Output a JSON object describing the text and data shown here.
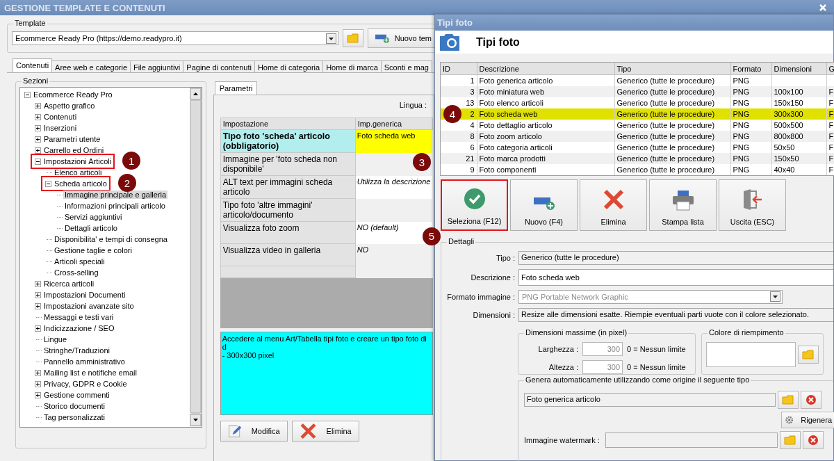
{
  "window": {
    "title": "GESTIONE TEMPLATE E CONTENUTI"
  },
  "template": {
    "label": "Template",
    "value": "Ecommerce Ready Pro (https://demo.readypro.it)",
    "new_button": "Nuovo tem"
  },
  "tabs": [
    {
      "label": "Contenuti",
      "selected": true
    },
    {
      "label": "Aree web e categorie",
      "selected": false
    },
    {
      "label": "File aggiuntivi",
      "selected": false
    },
    {
      "label": "Pagine di contenuti",
      "selected": false
    },
    {
      "label": "Home di categoria",
      "selected": false
    },
    {
      "label": "Home di marca",
      "selected": false
    },
    {
      "label": "Sconti e mag",
      "selected": false
    }
  ],
  "sections": {
    "label": "Sezioni",
    "tree": [
      {
        "label": "Ecommerce Ready Pro",
        "expanded": true,
        "selected": false,
        "children": [
          {
            "label": "Aspetto grafico",
            "expanded": false,
            "selected": false
          },
          {
            "label": "Contenuti",
            "expanded": false,
            "selected": false
          },
          {
            "label": "Inserzioni",
            "expanded": false,
            "selected": false
          },
          {
            "label": "Parametri utente",
            "expanded": false,
            "selected": false
          },
          {
            "label": "Carrello ed Ordini",
            "expanded": false,
            "selected": false
          },
          {
            "label": "Impostazioni Articoli",
            "expanded": true,
            "selected": false,
            "callout": "1",
            "children": [
              {
                "label": "Elenco articoli",
                "selected": false
              },
              {
                "label": "Scheda articolo",
                "expanded": true,
                "selected": false,
                "callout": "2",
                "children": [
                  {
                    "label": "Immagine principale e galleria",
                    "selected": true
                  },
                  {
                    "label": "Informazioni principali articolo",
                    "selected": false
                  },
                  {
                    "label": "Servizi aggiuntivi",
                    "selected": false
                  },
                  {
                    "label": "Dettagli articolo",
                    "selected": false
                  }
                ]
              },
              {
                "label": "Disponibilita' e tempi di consegna",
                "selected": false
              },
              {
                "label": "Gestione taglie e colori",
                "selected": false
              },
              {
                "label": "Articoli speciali",
                "selected": false
              },
              {
                "label": "Cross-selling",
                "selected": false
              }
            ]
          },
          {
            "label": "Ricerca articoli",
            "expanded": false,
            "selected": false
          },
          {
            "label": "Impostazioni Documenti",
            "expanded": false,
            "selected": false
          },
          {
            "label": "Impostazioni avanzate sito",
            "expanded": false,
            "selected": false
          },
          {
            "label": "Messaggi e testi vari",
            "selected": false
          },
          {
            "label": "Indicizzazione / SEO",
            "expanded": false,
            "selected": false
          },
          {
            "label": "Lingue",
            "selected": false
          },
          {
            "label": "Stringhe/Traduzioni",
            "selected": false
          },
          {
            "label": "Pannello amministrativo",
            "selected": false
          },
          {
            "label": "Mailing list e notifiche email",
            "expanded": false,
            "selected": false
          },
          {
            "label": "Privacy, GDPR e Cookie",
            "expanded": false,
            "selected": false
          },
          {
            "label": "Gestione commenti",
            "expanded": false,
            "selected": false
          },
          {
            "label": "Storico documenti",
            "selected": false
          },
          {
            "label": "Tag personalizzati",
            "selected": false
          }
        ]
      }
    ]
  },
  "params": {
    "tab": "Parametri",
    "language_label": "Lingua :",
    "columns": [
      "Impostazione",
      "Imp.generica"
    ],
    "rows": [
      {
        "setting": "Tipo foto 'scheda' articolo (obbligatorio)",
        "value": "Foto scheda web",
        "selected": true,
        "callout": "3"
      },
      {
        "setting": "Immagine per 'foto scheda non disponibile'",
        "selected": false
      },
      {
        "setting": "ALT text per immagini scheda articolo",
        "value": "Utilizza la descrizione",
        "selected": false
      },
      {
        "setting": "Tipo foto 'altre immagini' articolo/documento",
        "selected": false
      },
      {
        "setting": "Visualizza foto zoom",
        "value": "NO (default)",
        "selected": false
      },
      {
        "setting": "Visualizza video in galleria",
        "value": "NO",
        "selected": false
      }
    ],
    "description": "Accedere al menu Art/Tabella tipi foto e creare un tipo foto di d\n- 300x300 pixel",
    "buttons": [
      {
        "label": "Modifica",
        "kind": "edit"
      },
      {
        "label": "Elimina",
        "kind": "delete"
      }
    ]
  },
  "dialog": {
    "title": "Tipi foto",
    "heading": "Tipi foto",
    "columns": [
      "ID",
      "Descrizione",
      "Tipo",
      "Formato",
      "Dimensioni",
      "G"
    ],
    "rows": [
      {
        "id": "1",
        "description": "Foto generica articolo",
        "type": "Generico (tutte le procedure)",
        "format": "PNG",
        "selected": false
      },
      {
        "id": "3",
        "description": "Foto miniatura web",
        "type": "Generico (tutte le procedure)",
        "format": "PNG",
        "size": "100x100",
        "column_6": "F",
        "selected": false
      },
      {
        "id": "13",
        "description": "Foto elenco articoli",
        "type": "Generico (tutte le procedure)",
        "format": "PNG",
        "size": "150x150",
        "column_6": "F",
        "selected": false
      },
      {
        "id": "2",
        "description": "Foto scheda web",
        "type": "Generico (tutte le procedure)",
        "format": "PNG",
        "size": "300x300",
        "column_6": "F",
        "selected": true,
        "callout": "4"
      },
      {
        "id": "4",
        "description": "Foto dettaglio articolo",
        "type": "Generico (tutte le procedure)",
        "format": "PNG",
        "size": "500x500",
        "column_6": "F",
        "selected": false
      },
      {
        "id": "8",
        "description": "Foto zoom articolo",
        "type": "Generico (tutte le procedure)",
        "format": "PNG",
        "size": "800x800",
        "column_6": "F",
        "selected": false
      },
      {
        "id": "6",
        "description": "Foto categoria articoli",
        "type": "Generico (tutte le procedure)",
        "format": "PNG",
        "size": "50x50",
        "column_6": "F",
        "selected": false
      },
      {
        "id": "21",
        "description": "Foto marca prodotti",
        "type": "Generico (tutte le procedure)",
        "format": "PNG",
        "size": "150x50",
        "column_6": "F",
        "selected": false
      },
      {
        "id": "9",
        "description": "Foto componenti",
        "type": "Generico (tutte le procedure)",
        "format": "PNG",
        "size": "40x40",
        "column_6": "F",
        "selected": false
      }
    ],
    "toolbar": [
      {
        "label": "Seleziona (F12)",
        "kind": "select",
        "callout": "5"
      },
      {
        "label": "Nuovo (F4)",
        "kind": "new"
      },
      {
        "label": "Elimina",
        "kind": "delete"
      },
      {
        "label": "Stampa lista",
        "kind": "print"
      },
      {
        "label": "Uscita (ESC)",
        "kind": "exit"
      }
    ],
    "details": {
      "label": "Dettagli",
      "type_label": "Tipo :",
      "type_value": "Generico (tutte le procedure)",
      "description_label": "Descrizione :",
      "description_value": "Foto scheda web",
      "format_label": "Formato immagine :",
      "format_value": "PNG Portable Network Graphic",
      "size_label": "Dimensioni :",
      "size_value": "Resize alle dimensioni esatte. Riempie eventuali parti vuote con il colore selezionato.",
      "max_group": "Dimensioni massime (in pixel)",
      "width_label": "Larghezza :",
      "width_value": "300",
      "width_hint": "0 = Nessun limite",
      "height_label": "Altezza :",
      "height_value": "300",
      "height_hint": "0 = Nessun limite",
      "fill_group": "Colore di riempimento",
      "generate_group": "Genera automaticamente utilizzando come origine il seguente tipo",
      "source_value": "Foto generica articolo",
      "regenerate_button": "Rigenera",
      "watermark_label": "Immagine watermark :"
    }
  }
}
